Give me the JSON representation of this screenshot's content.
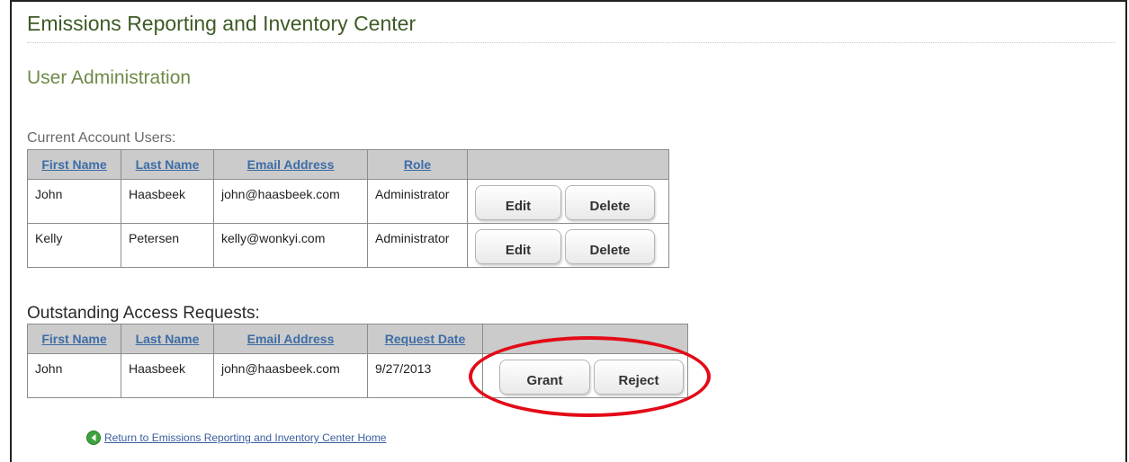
{
  "app": {
    "title": "Emissions Reporting and Inventory Center"
  },
  "page": {
    "title": "User Administration"
  },
  "current_users": {
    "caption": "Current Account Users:",
    "columns": [
      "First Name",
      "Last Name",
      "Email Address",
      "Role"
    ],
    "rows": [
      {
        "first_name": "John",
        "last_name": "Haasbeek",
        "email": "john@haasbeek.com",
        "role": "Administrator",
        "edit_label": "Edit",
        "delete_label": "Delete"
      },
      {
        "first_name": "Kelly",
        "last_name": "Petersen",
        "email": "kelly@wonkyi.com",
        "role": "Administrator",
        "edit_label": "Edit",
        "delete_label": "Delete"
      }
    ]
  },
  "access_requests": {
    "caption": "Outstanding Access Requests:",
    "columns": [
      "First Name",
      "Last Name",
      "Email Address",
      "Request Date"
    ],
    "rows": [
      {
        "first_name": "John",
        "last_name": "Haasbeek",
        "email": "john@haasbeek.com",
        "request_date": "9/27/2013",
        "grant_label": "Grant",
        "reject_label": "Reject"
      }
    ]
  },
  "footer": {
    "return_link": "Return to Emissions Reporting and Inventory Center Home",
    "return_icon": "back-arrow-circle-icon"
  },
  "annotation": {
    "highlight_color": "#e30b17"
  },
  "colors": {
    "title": "#3e5a25",
    "subtitle": "#6e8a48",
    "header_bg": "#cbcbcb",
    "link": "#3d6da6"
  }
}
